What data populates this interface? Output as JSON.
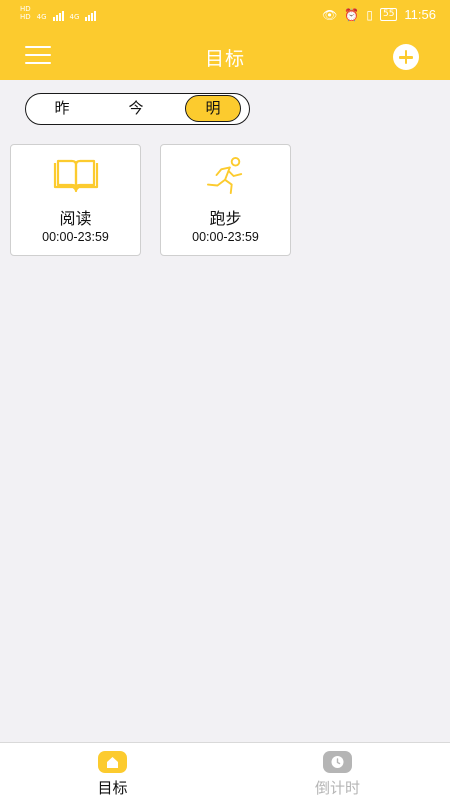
{
  "status_bar": {
    "time": "11:56",
    "battery": "55",
    "net_label": "4G"
  },
  "header": {
    "title": "目标"
  },
  "day_selector": {
    "options": [
      "昨",
      "今",
      "明"
    ],
    "selected": "明"
  },
  "goals": [
    {
      "name": "阅读",
      "time": "00:00-23:59",
      "icon": "book-icon"
    },
    {
      "name": "跑步",
      "time": "00:00-23:59",
      "icon": "running-person-icon"
    }
  ],
  "bottom_nav": {
    "items": [
      {
        "label": "目标",
        "icon": "home-icon",
        "active": true
      },
      {
        "label": "倒计时",
        "icon": "clock-icon",
        "active": false
      }
    ]
  },
  "colors": {
    "accent": "#fccb2e",
    "inactive": "#b5b5b5",
    "background": "#f2f1f4"
  }
}
